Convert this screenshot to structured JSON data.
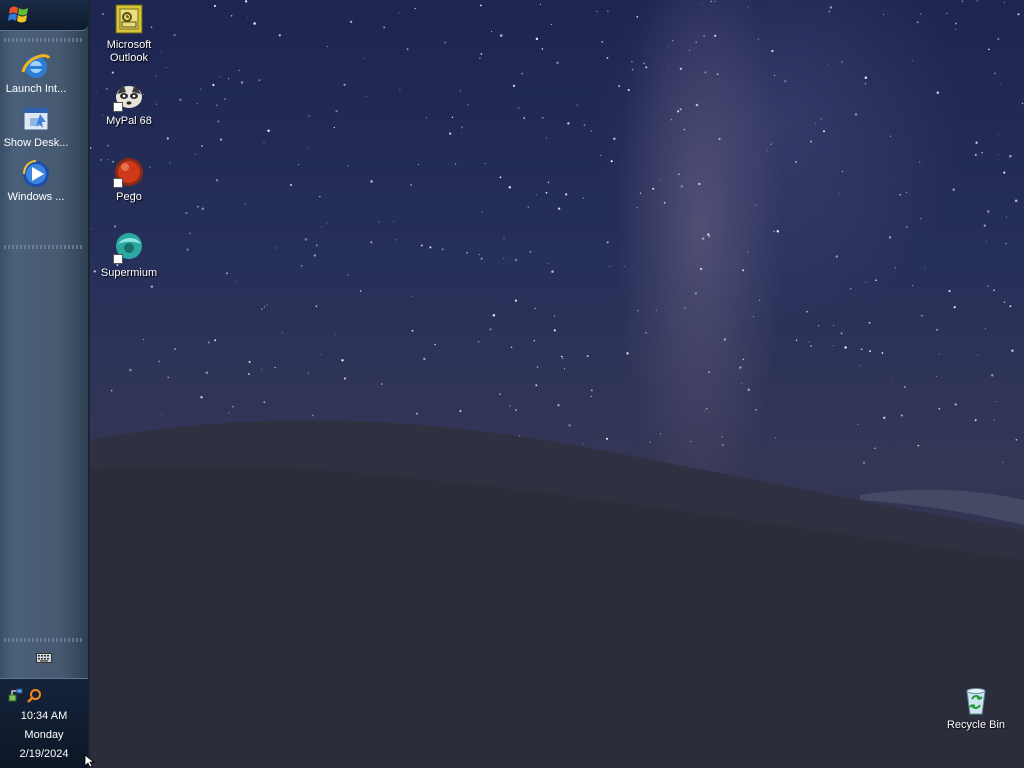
{
  "taskbar": {
    "quick_launch": [
      {
        "label": "Launch Int...",
        "icon": "internet-explorer-icon"
      },
      {
        "label": "Show Desk...",
        "icon": "show-desktop-icon"
      },
      {
        "label": "Windows ...",
        "icon": "windows-media-player-icon"
      }
    ],
    "tray": {
      "time": "10:34 AM",
      "day": "Monday",
      "date": "2/19/2024"
    }
  },
  "desktop": {
    "icons": [
      {
        "label": "Microsoft Outlook",
        "icon": "outlook-icon"
      },
      {
        "label": "MyPal 68",
        "icon": "mypal-icon"
      },
      {
        "label": "Pego",
        "icon": "pego-icon"
      },
      {
        "label": "Supermium",
        "icon": "supermium-icon"
      },
      {
        "label": "Recycle Bin",
        "icon": "recycle-bin-icon"
      }
    ]
  },
  "colors": {
    "taskbar": "#45596f",
    "tray": "#0c1626",
    "sky": "#1d2550"
  }
}
